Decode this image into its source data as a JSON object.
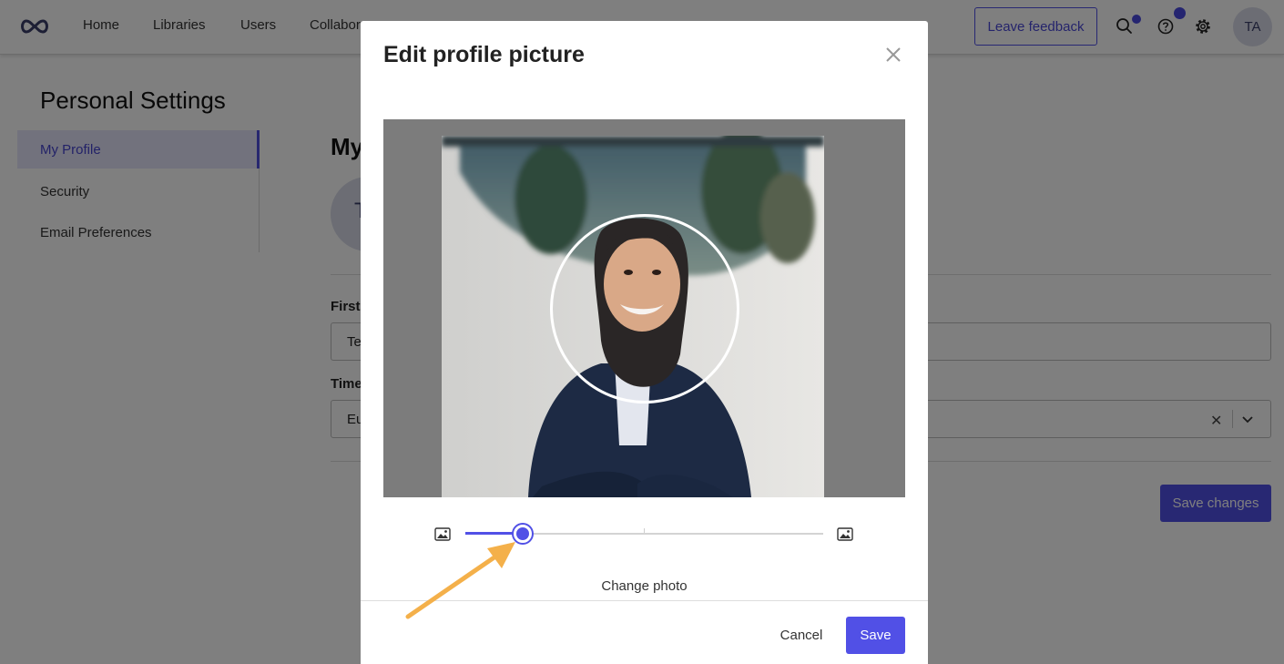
{
  "nav": {
    "items": [
      "Home",
      "Libraries",
      "Users",
      "Collabor"
    ],
    "feedback_label": "Leave feedback",
    "avatar_initials": "TA",
    "icons": [
      "infinity-logo-icon",
      "search-icon",
      "help-icon",
      "gear-icon"
    ]
  },
  "settings": {
    "title": "Personal Settings",
    "sidebar": [
      {
        "label": "My Profile",
        "active": true
      },
      {
        "label": "Security",
        "active": false
      },
      {
        "label": "Email Preferences",
        "active": false
      }
    ]
  },
  "profile": {
    "heading": "My",
    "avatar_text": "T",
    "first_label": "First",
    "first_value": "Te",
    "time_label": "Time",
    "time_value": "Eu",
    "save_changes_label": "Save changes"
  },
  "modal": {
    "title": "Edit profile picture",
    "zoom_level": 0.16,
    "change_photo_label": "Change photo",
    "cancel_label": "Cancel",
    "save_label": "Save"
  },
  "colors": {
    "accent": "#5150e6",
    "annotation_arrow": "#f4b04a"
  }
}
